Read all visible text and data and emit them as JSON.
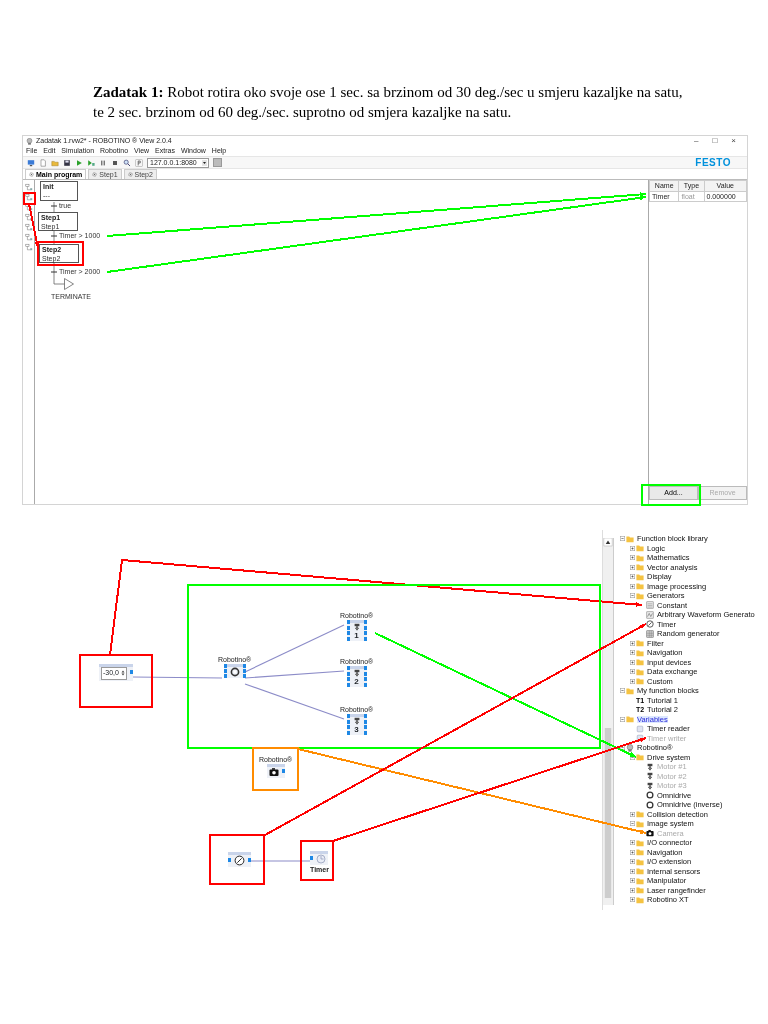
{
  "task": "**Zadatak 1:** Robot rotira oko svoje ose 1 sec. sa brzinom od 30 deg./sec u smjeru kazaljke na satu, te 2 sec. brzinom od 60 deg./sec. suprotno od smjera kazaljke na satu.",
  "program_window": {
    "title": "Zadatak 1.rvw2* - ROBOTINO ® View 2.0.4",
    "window_controls": [
      "–",
      "□",
      "×"
    ],
    "menu": [
      "File",
      "Edit",
      "Simulation",
      "Robotino",
      "View",
      "Extras",
      "Window",
      "Help"
    ],
    "address": "127.0.0.1:8080",
    "logo": "FESTO",
    "tabs": [
      {
        "label": "Main program",
        "selected": true
      },
      {
        "label": "Step1",
        "selected": false
      },
      {
        "label": "Step2",
        "selected": false
      }
    ],
    "sequence": {
      "steps": [
        {
          "name": "Init",
          "subtitle": "---"
        },
        {
          "name": "Step1",
          "subtitle": "Step1"
        },
        {
          "name": "Step2",
          "subtitle": "Step2"
        }
      ],
      "transitions": [
        "true",
        "Timer > 1000",
        "Timer > 2000"
      ],
      "end": "TERMINATE"
    },
    "variables": {
      "columns": [
        "Name",
        "Type",
        "Value"
      ],
      "rows": [
        [
          "Timer",
          "float",
          "0.000000"
        ]
      ]
    },
    "buttons": [
      {
        "label": "Add...",
        "disabled": false
      },
      {
        "label": "Remove",
        "disabled": true
      }
    ],
    "annotations": [
      {
        "kind": "box",
        "color": "#ff0000"
      },
      {
        "kind": "arrow",
        "color": "#ff0000"
      },
      {
        "kind": "box",
        "color": "#ff0000"
      },
      {
        "kind": "arrow",
        "color": "#00ff00"
      },
      {
        "kind": "arrow",
        "color": "#00ff00"
      },
      {
        "kind": "box",
        "color": "#00ff00"
      }
    ]
  },
  "block_diagram": {
    "nodes": [
      {
        "kind": "constant",
        "value": "-30,0"
      },
      {
        "kind": "omnidrive",
        "label": "Robotino®"
      },
      {
        "kind": "motor",
        "label": "Robotino®",
        "number": "1"
      },
      {
        "kind": "motor",
        "label": "Robotino®",
        "number": "2"
      },
      {
        "kind": "motor",
        "label": "Robotino®",
        "number": "3"
      },
      {
        "kind": "camera",
        "label": "Robotino®"
      },
      {
        "kind": "timer"
      },
      {
        "kind": "variable",
        "label": "Timer"
      }
    ],
    "annotations": [
      {
        "kind": "box",
        "color": "#ff0000"
      },
      {
        "kind": "arrow",
        "color": "#ff0000"
      },
      {
        "kind": "box",
        "color": "#00ff00"
      },
      {
        "kind": "arrow",
        "color": "#00ff00"
      },
      {
        "kind": "box",
        "color": "#ff8c00"
      },
      {
        "kind": "arrow",
        "color": "#ff8c00"
      },
      {
        "kind": "box",
        "color": "#ff0000"
      },
      {
        "kind": "arrow",
        "color": "#ff0000"
      },
      {
        "kind": "box",
        "color": "#ff0000"
      },
      {
        "kind": "arrow",
        "color": "#ff0000"
      }
    ]
  },
  "library_tree": {
    "items": [
      {
        "label": "Function block library",
        "kind": "folder",
        "expanded": true,
        "selected": false,
        "disabled": false,
        "children": [
          {
            "label": "Logic",
            "kind": "folder",
            "expanded": false,
            "selected": false,
            "disabled": false
          },
          {
            "label": "Mathematics",
            "kind": "folder",
            "expanded": false,
            "selected": false,
            "disabled": false
          },
          {
            "label": "Vector analysis",
            "kind": "folder",
            "expanded": false,
            "selected": false,
            "disabled": false
          },
          {
            "label": "Display",
            "kind": "folder",
            "expanded": false,
            "selected": false,
            "disabled": false
          },
          {
            "label": "Image processing",
            "kind": "folder",
            "expanded": false,
            "selected": false,
            "disabled": false
          },
          {
            "label": "Generators",
            "kind": "folder",
            "expanded": true,
            "selected": false,
            "disabled": false,
            "children": [
              {
                "label": "Constant",
                "kind": "constant",
                "selected": false,
                "disabled": false
              },
              {
                "label": "Arbitrary Waveform Generato",
                "kind": "waveform",
                "selected": false,
                "disabled": false
              },
              {
                "label": "Timer",
                "kind": "timer",
                "selected": false,
                "disabled": false
              },
              {
                "label": "Random generator",
                "kind": "random",
                "selected": false,
                "disabled": false
              }
            ]
          },
          {
            "label": "Filter",
            "kind": "folder",
            "expanded": false,
            "selected": false,
            "disabled": false
          },
          {
            "label": "Navigation",
            "kind": "folder",
            "expanded": false,
            "selected": false,
            "disabled": false
          },
          {
            "label": "Input devices",
            "kind": "folder",
            "expanded": false,
            "selected": false,
            "disabled": false
          },
          {
            "label": "Data exchange",
            "kind": "folder",
            "expanded": false,
            "selected": false,
            "disabled": false
          },
          {
            "label": "Custom",
            "kind": "folder",
            "expanded": false,
            "selected": false,
            "disabled": false
          }
        ]
      },
      {
        "label": "My function blocks",
        "kind": "folder",
        "expanded": true,
        "selected": false,
        "disabled": false,
        "children": [
          {
            "label": "Tutorial 1",
            "kind": "function",
            "icon_text": "T1",
            "selected": false,
            "disabled": false
          },
          {
            "label": "Tutorial 2",
            "kind": "function",
            "icon_text": "T2",
            "selected": false,
            "disabled": false
          }
        ]
      },
      {
        "label": "Variables",
        "kind": "folder",
        "expanded": true,
        "selected": true,
        "disabled": false,
        "children": [
          {
            "label": "Timer reader",
            "kind": "variable",
            "selected": false,
            "disabled": false
          },
          {
            "label": "Timer writer",
            "kind": "variable",
            "selected": false,
            "disabled": true
          }
        ]
      },
      {
        "label": "Robotino®",
        "kind": "robot",
        "expanded": true,
        "selected": false,
        "disabled": false,
        "children": [
          {
            "label": "Drive system",
            "kind": "folder",
            "expanded": true,
            "selected": false,
            "disabled": false,
            "children": [
              {
                "label": "Motor #1",
                "kind": "motor",
                "selected": false,
                "disabled": true
              },
              {
                "label": "Motor #2",
                "kind": "motor",
                "selected": false,
                "disabled": true
              },
              {
                "label": "Motor #3",
                "kind": "motor",
                "selected": false,
                "disabled": true
              },
              {
                "label": "Omnidrive",
                "kind": "omnidrive",
                "selected": false,
                "disabled": false
              },
              {
                "label": "Omnidrive (inverse)",
                "kind": "omnidrive",
                "selected": false,
                "disabled": false
              }
            ]
          },
          {
            "label": "Collision detection",
            "kind": "folder",
            "expanded": false,
            "selected": false,
            "disabled": false
          },
          {
            "label": "Image system",
            "kind": "folder",
            "expanded": true,
            "selected": false,
            "disabled": false,
            "children": [
              {
                "label": "Camera",
                "kind": "camera",
                "selected": false,
                "disabled": true
              }
            ]
          },
          {
            "label": "I/O connector",
            "kind": "folder",
            "expanded": false,
            "selected": false,
            "disabled": false
          },
          {
            "label": "Navigation",
            "kind": "folder",
            "expanded": false,
            "selected": false,
            "disabled": false
          },
          {
            "label": "I/O extension",
            "kind": "folder",
            "expanded": false,
            "selected": false,
            "disabled": false
          },
          {
            "label": "Internal sensors",
            "kind": "folder",
            "expanded": false,
            "selected": false,
            "disabled": false
          },
          {
            "label": "Manipulator",
            "kind": "folder",
            "expanded": false,
            "selected": false,
            "disabled": false
          },
          {
            "label": "Laser rangefinder",
            "kind": "folder",
            "expanded": false,
            "selected": false,
            "disabled": false
          },
          {
            "label": "Robotino XT",
            "kind": "folder",
            "expanded": false,
            "selected": false,
            "disabled": false
          }
        ]
      }
    ]
  }
}
